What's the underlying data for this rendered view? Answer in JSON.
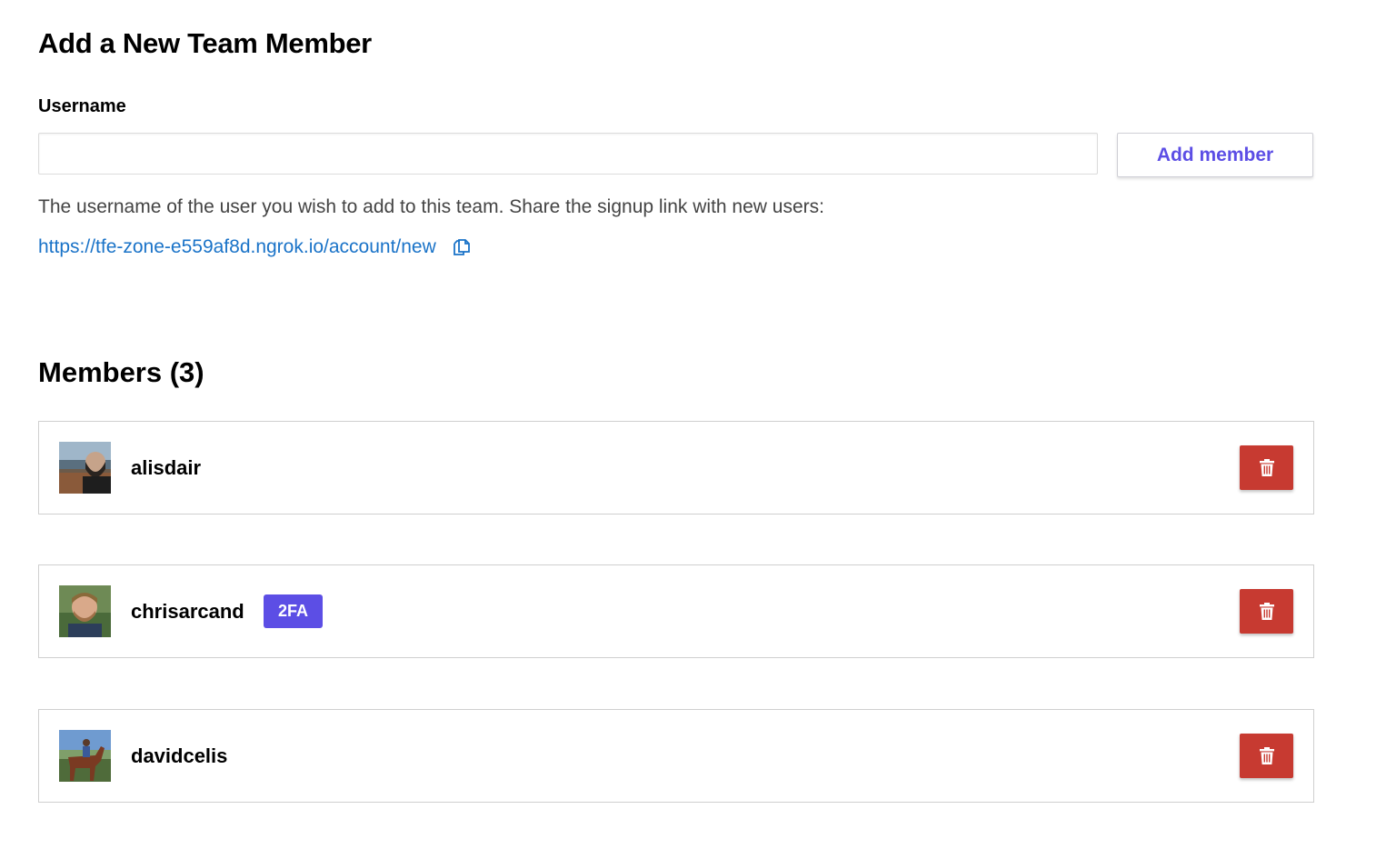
{
  "add_section": {
    "title": "Add a New Team Member",
    "username_label": "Username",
    "username_value": "",
    "username_placeholder": "",
    "add_button_label": "Add member",
    "help_text": "The username of the user you wish to add to this team. Share the signup link with new users:",
    "signup_link": "https://tfe-zone-e559af8d.ngrok.io/account/new",
    "copy_icon": "copy-icon"
  },
  "members_section": {
    "title": "Members (3)",
    "members": [
      {
        "username": "alisdair",
        "badge": ""
      },
      {
        "username": "chrisarcand",
        "badge": "2FA"
      },
      {
        "username": "davidcelis",
        "badge": ""
      }
    ],
    "delete_icon": "trash-icon"
  },
  "colors": {
    "accent": "#5c4ee5",
    "link": "#1a73c8",
    "danger": "#c73a31"
  }
}
